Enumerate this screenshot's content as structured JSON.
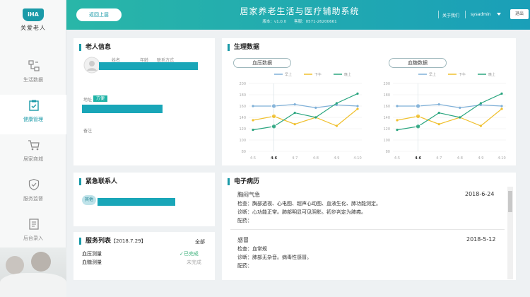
{
  "logo": {
    "badge": "iHA",
    "text": "关爱老人"
  },
  "sidebar": {
    "items": [
      {
        "label": "生活数据",
        "icon": "flowchart-icon"
      },
      {
        "label": "健康管理",
        "icon": "clipboard-icon"
      },
      {
        "label": "居家商城",
        "icon": "cart-icon"
      },
      {
        "label": "服务监督",
        "icon": "shield-icon"
      },
      {
        "label": "后台录入",
        "icon": "document-icon"
      }
    ]
  },
  "header": {
    "back_label": "返回上层",
    "title": "居家养老生活与医疗辅助系统",
    "version": "版本：v1.0.0　　客服：0571-26200661",
    "about": "关于我们",
    "user": "sysadmin",
    "exit": "退出"
  },
  "elder": {
    "title": "老人信息",
    "cols": [
      "姓名",
      "年龄",
      "联系方式"
    ],
    "address_label": "地址",
    "address_tag": "方便",
    "note_label": "备注"
  },
  "contact": {
    "title": "紧急联系人",
    "tag": "其他"
  },
  "services": {
    "title": "服务列表",
    "date": "【2018.7.29】",
    "all": "全部",
    "items": [
      {
        "name": "血压测量",
        "status": "✓已完成",
        "done": true
      },
      {
        "name": "血糖测量",
        "status": "未完成",
        "done": false
      }
    ]
  },
  "physio": {
    "title": "生理数据",
    "bp_label": "血压数据",
    "bg_label": "血糖数据"
  },
  "chart_data": [
    {
      "type": "line",
      "title": "血压数据",
      "x": [
        "4-5",
        "4-6",
        "4-7",
        "4-8",
        "4-9",
        "4-10"
      ],
      "ylim": [
        80,
        200
      ],
      "yticks": [
        80,
        100,
        120,
        140,
        160,
        180,
        200
      ],
      "legend": [
        "早上",
        "下午",
        "晚上"
      ],
      "series": [
        {
          "name": "早上",
          "color": "#7fb0d8",
          "values": [
            160,
            160,
            163,
            157,
            162,
            160
          ]
        },
        {
          "name": "下午",
          "color": "#f0c02e",
          "values": [
            135,
            142,
            128,
            140,
            125,
            155
          ]
        },
        {
          "name": "晚上",
          "color": "#2aa57f",
          "values": [
            118,
            124,
            148,
            140,
            165,
            182
          ]
        }
      ]
    },
    {
      "type": "line",
      "title": "血糖数据",
      "x": [
        "4-5",
        "4-6",
        "4-7",
        "4-8",
        "4-9",
        "4-10"
      ],
      "ylim": [
        80,
        200
      ],
      "yticks": [
        80,
        100,
        120,
        140,
        160,
        180,
        200
      ],
      "legend": [
        "早上",
        "下午",
        "晚上"
      ],
      "series": [
        {
          "name": "早上",
          "color": "#7fb0d8",
          "values": [
            160,
            160,
            163,
            157,
            162,
            160
          ]
        },
        {
          "name": "下午",
          "color": "#f0c02e",
          "values": [
            135,
            142,
            128,
            140,
            125,
            155
          ]
        },
        {
          "name": "晚上",
          "color": "#2aa57f",
          "values": [
            118,
            124,
            148,
            140,
            165,
            182
          ]
        }
      ]
    }
  ],
  "records": {
    "title": "电子病历",
    "items": [
      {
        "name": "胸闷气急",
        "date": "2018-6-24",
        "exam": "检查：胸部透视、心电图、超声心动图、血液生化、肺功能测定。",
        "diag": "诊断：心功能正常。肺部明显可见阴影。初步判定为肺癌。",
        "med": "配药："
      },
      {
        "name": "感冒",
        "date": "2018-5-12",
        "exam": "检查：血常规",
        "diag": "诊断：肺部无杂音。病毒性感冒。",
        "med": "配药："
      }
    ]
  }
}
